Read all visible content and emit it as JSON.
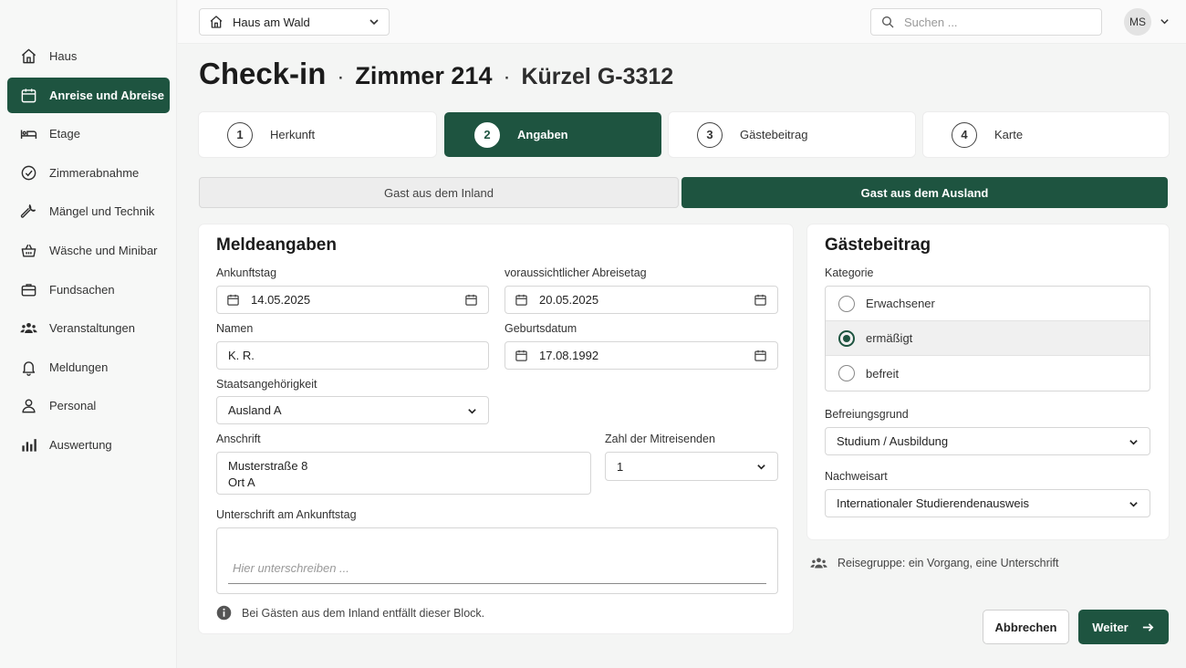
{
  "colors": {
    "accent": "#1e5440",
    "background": "#f4f5f4"
  },
  "topbar": {
    "house_select": {
      "value": "Haus am Wald",
      "icon": "home-icon"
    },
    "search": {
      "placeholder": "Suchen ..."
    },
    "user": {
      "initials": "MS"
    }
  },
  "sidebar": {
    "items": [
      {
        "label": "Haus",
        "icon": "home-icon",
        "active": false
      },
      {
        "label": "Anreise und Abreise",
        "icon": "calendar-icon",
        "active": true
      },
      {
        "label": "Etage",
        "icon": "bed-icon",
        "active": false
      },
      {
        "label": "Zimmerabnahme",
        "icon": "check-circle-icon",
        "active": false
      },
      {
        "label": "Mängel und Technik",
        "icon": "wrench-icon",
        "active": false
      },
      {
        "label": "Wäsche und Minibar",
        "icon": "basket-icon",
        "active": false
      },
      {
        "label": "Fundsachen",
        "icon": "briefcase-icon",
        "active": false
      },
      {
        "label": "Veranstaltungen",
        "icon": "people-icon",
        "active": false
      },
      {
        "label": "Meldungen",
        "icon": "bell-icon",
        "active": false
      },
      {
        "label": "Personal",
        "icon": "person-icon",
        "active": false
      },
      {
        "label": "Auswertung",
        "icon": "bar-chart-icon",
        "active": false
      }
    ]
  },
  "header": {
    "title": "Check-in",
    "separator": "·",
    "room": "Zimmer 214",
    "code": "Kürzel G-3312"
  },
  "steps": [
    {
      "number": "1",
      "label": "Herkunft",
      "active": false
    },
    {
      "number": "2",
      "label": "Angaben",
      "active": true
    },
    {
      "number": "3",
      "label": "Gästebeitrag",
      "active": false
    },
    {
      "number": "4",
      "label": "Karte",
      "active": false
    }
  ],
  "guest_type": {
    "domestic": "Gast aus dem Inland",
    "foreign": "Gast aus dem Ausland",
    "selected": "foreign"
  },
  "registration": {
    "title": "Meldeangaben",
    "arrival": {
      "label": "Ankunftstag",
      "value": "14.05.2025"
    },
    "departure": {
      "label": "voraussichtlicher Abreisetag",
      "value": "20.05.2025"
    },
    "name": {
      "label": "Namen",
      "value": "K. R."
    },
    "birthdate": {
      "label": "Geburtsdatum",
      "value": "17.08.1992"
    },
    "nationality": {
      "label": "Staatsangehörigkeit",
      "value": "Ausland A"
    },
    "address": {
      "label": "Anschrift",
      "line1": "Musterstraße 8",
      "line2": "Ort A"
    },
    "companions": {
      "label": "Zahl der Mitreisenden",
      "value": "1"
    },
    "signature": {
      "label": "Unterschrift am Ankunftstag",
      "placeholder": "Hier unterschreiben ..."
    },
    "info": "Bei Gästen aus dem Inland entfällt dieser Block."
  },
  "guest_fee": {
    "title": "Gästebeitrag",
    "category_label": "Kategorie",
    "categories": [
      {
        "label": "Erwachsener",
        "selected": false
      },
      {
        "label": "ermäßigt",
        "selected": true
      },
      {
        "label": "befreit",
        "selected": false
      }
    ],
    "reason": {
      "label": "Befreiungsgrund",
      "value": "Studium / Ausbildung"
    },
    "proof": {
      "label": "Nachweisart",
      "value": "Internationaler Studierendenausweis"
    }
  },
  "group_note": "Reisegruppe: ein Vorgang, eine Unterschrift",
  "actions": {
    "cancel": "Abbrechen",
    "next": "Weiter"
  }
}
